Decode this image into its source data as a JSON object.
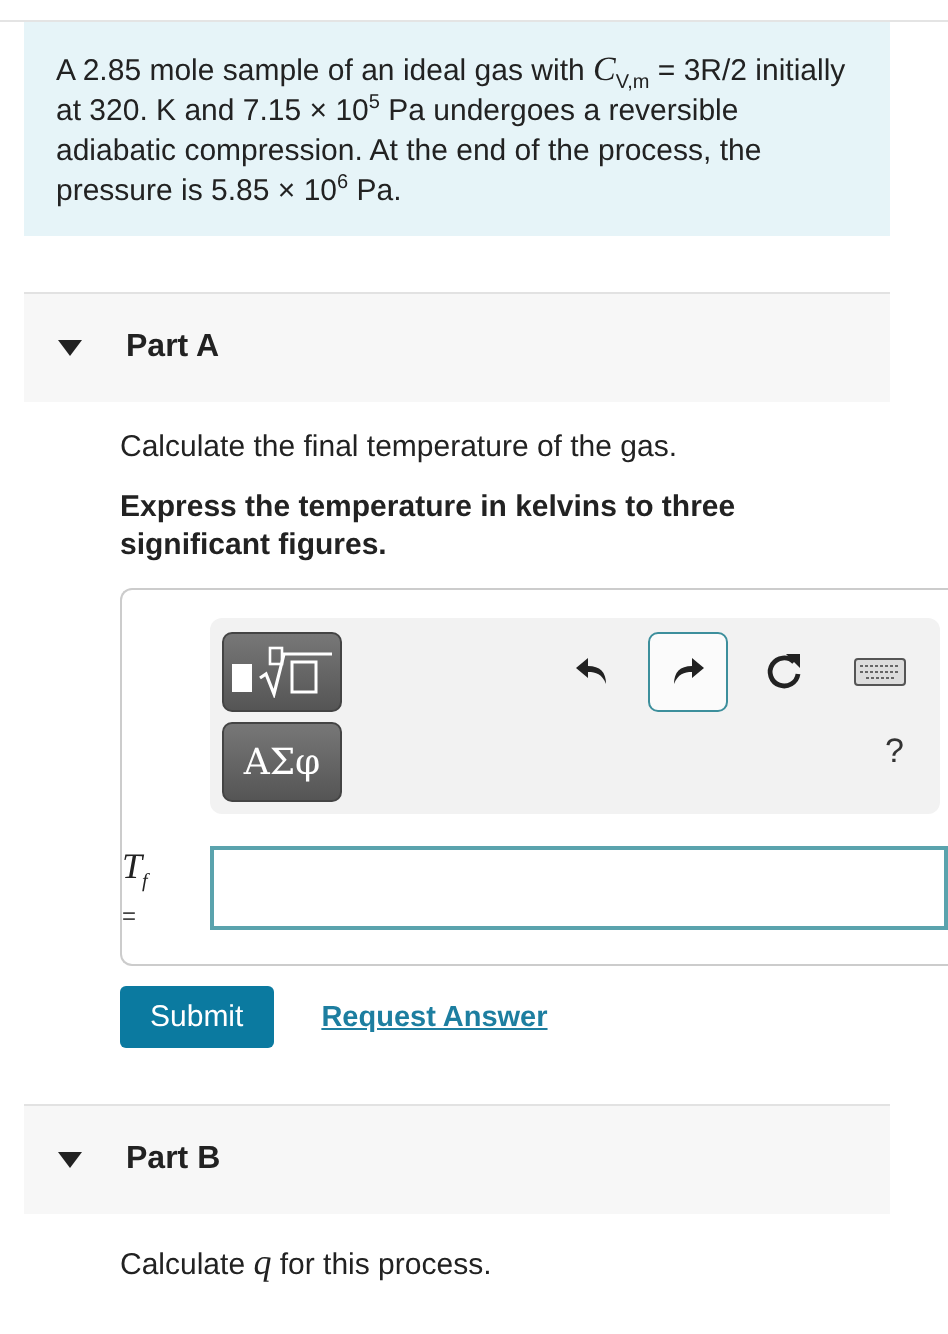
{
  "problem": "A 2.85 mole sample of an ideal gas with *C*$_{V,m}$ = 3R/2 initially at 320. K and 7.15 × 10$^{5}$ Pa undergoes a reversible adiabatic compression. At the end of the process, the pressure is 5.85 × 10$^{6}$ Pa.",
  "parts": [
    {
      "title": "Part A",
      "expanded": true,
      "question": "Calculate the final temperature of the gas.",
      "instruction": "Express the temperature in kelvins to three significant figures.",
      "answer": {
        "greek_button": "ΑΣφ",
        "tools": [
          {
            "kind": "undo",
            "selected": false
          },
          {
            "kind": "redo",
            "selected": true
          },
          {
            "kind": "reset",
            "selected": false
          },
          {
            "kind": "keyboard",
            "selected": false
          }
        ],
        "help": "?",
        "variable": "*T*$_{f}$",
        "equals": "=",
        "submit": "Submit",
        "request": "Request Answer"
      }
    },
    {
      "title": "Part B",
      "expanded": true,
      "question": "Calculate *q* for this process."
    }
  ]
}
